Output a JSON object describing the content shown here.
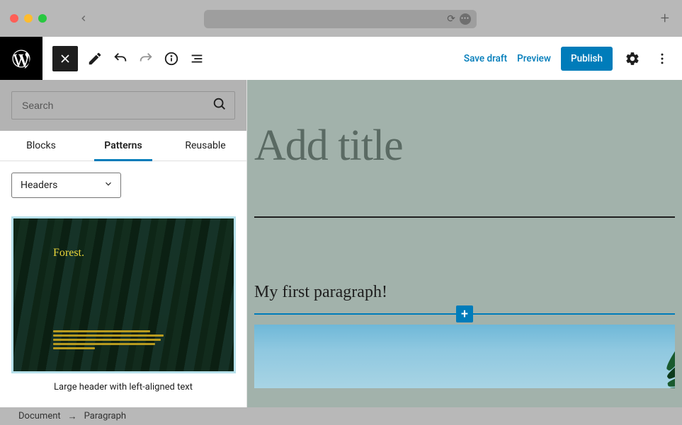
{
  "colors": {
    "accent": "#007cba"
  },
  "toolbar": {
    "save_draft": "Save draft",
    "preview": "Preview",
    "publish": "Publish"
  },
  "sidebar": {
    "search_placeholder": "Search",
    "tabs": {
      "blocks": "Blocks",
      "patterns": "Patterns",
      "reusable": "Reusable"
    },
    "category": "Headers",
    "pattern": {
      "thumb_label": "Forest.",
      "caption": "Large header with left-aligned text"
    }
  },
  "editor": {
    "title_placeholder": "Add title",
    "paragraph": "My first paragraph!"
  },
  "breadcrumb": {
    "root": "Document",
    "leaf": "Paragraph"
  },
  "icons": {
    "close": "close-icon",
    "pen": "pen-icon",
    "undo": "undo-icon",
    "redo": "redo-icon",
    "info": "info-icon",
    "outline": "outline-icon",
    "gear": "gear-icon",
    "kebab": "kebab-icon",
    "search": "search-icon",
    "chevron": "chevron-down-icon",
    "plus": "plus-icon",
    "wp": "wordpress-logo-icon",
    "back": "back-icon",
    "reload": "reload-icon",
    "newtab": "new-tab-icon"
  }
}
